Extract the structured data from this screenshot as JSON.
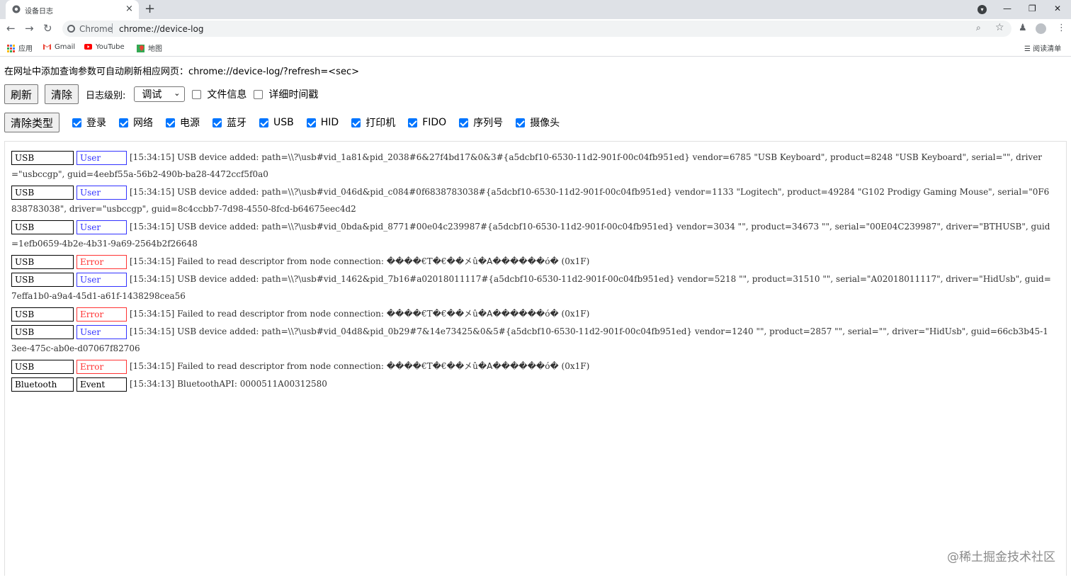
{
  "browser": {
    "tab_title": "设备日志",
    "tab_close": "×",
    "new_tab": "+",
    "omnibox_origin": "Chrome",
    "omnibox_url": "chrome://device-log",
    "window_controls": {
      "minimize": "—",
      "restore": "❐",
      "close": "✕"
    },
    "bookmarks": [
      {
        "label": "应用",
        "icon": "apps-grid-icon"
      },
      {
        "label": "Gmail",
        "icon": "gmail-icon"
      },
      {
        "label": "YouTube",
        "icon": "youtube-icon"
      },
      {
        "label": "地图",
        "icon": "maps-icon"
      }
    ],
    "reading_list": "阅读清单"
  },
  "page": {
    "hint": "在网址中添加查询参数可自动刷新相应网页：chrome://device-log/?refresh=<sec>",
    "refresh_label": "刷新",
    "clear_label": "清除",
    "log_level_label": "日志级别:",
    "log_level_value": "调试",
    "file_info_label": "文件信息",
    "detailed_timestamp_label": "详细时间戳",
    "clear_types_label": "清除类型",
    "types": [
      {
        "label": "登录",
        "checked": true
      },
      {
        "label": "网络",
        "checked": true
      },
      {
        "label": "电源",
        "checked": true
      },
      {
        "label": "蓝牙",
        "checked": true
      },
      {
        "label": "USB",
        "checked": true
      },
      {
        "label": "HID",
        "checked": true
      },
      {
        "label": "打印机",
        "checked": true
      },
      {
        "label": "FIDO",
        "checked": true
      },
      {
        "label": "序列号",
        "checked": true
      },
      {
        "label": "摄像头",
        "checked": true
      }
    ]
  },
  "log": [
    {
      "type": "USB",
      "level": "User",
      "text": "[15:34:15] USB device added: path=\\\\?\\usb#vid_1a81&pid_2038#6&27f4bd17&0&3#{a5dcbf10-6530-11d2-901f-00c04fb951ed} vendor=6785 \"USB Keyboard\", product=8248 \"USB Keyboard\", serial=\"\", driver=\"usbccgp\", guid=4eebf55a-56b2-490b-ba28-4472ccf5f0a0"
    },
    {
      "type": "USB",
      "level": "User",
      "text": "[15:34:15] USB device added: path=\\\\?\\usb#vid_046d&pid_c084#0f6838783038#{a5dcbf10-6530-11d2-901f-00c04fb951ed} vendor=1133 \"Logitech\", product=49284 \"G102 Prodigy Gaming Mouse\", serial=\"0F6838783038\", driver=\"usbccgp\", guid=8c4ccbb7-7d98-4550-8fcd-b64675eec4d2"
    },
    {
      "type": "USB",
      "level": "User",
      "text": "[15:34:15] USB device added: path=\\\\?\\usb#vid_0bda&pid_8771#00e04c239987#{a5dcbf10-6530-11d2-901f-00c04fb951ed} vendor=3034 \"\", product=34673 \"\", serial=\"00E04C239987\", driver=\"BTHUSB\", guid=1efb0659-4b2e-4b31-9a69-2564b2f26648"
    },
    {
      "type": "USB",
      "level": "Error",
      "text": "[15:34:15] Failed to read descriptor from node connection: ����€T�€��㐅û�ꓮ������ó� (0x1F)"
    },
    {
      "type": "USB",
      "level": "User",
      "text": "[15:34:15] USB device added: path=\\\\?\\usb#vid_1462&pid_7b16#a02018011117#{a5dcbf10-6530-11d2-901f-00c04fb951ed} vendor=5218 \"\", product=31510 \"\", serial=\"A02018011117\", driver=\"HidUsb\", guid=7effa1b0-a9a4-45d1-a61f-1438298cea56"
    },
    {
      "type": "USB",
      "level": "Error",
      "text": "[15:34:15] Failed to read descriptor from node connection: ����€T�€��㐅û�ꓮ������ó� (0x1F)"
    },
    {
      "type": "USB",
      "level": "User",
      "text": "[15:34:15] USB device added: path=\\\\?\\usb#vid_04d8&pid_0b29#7&14e73425&0&5#{a5dcbf10-6530-11d2-901f-00c04fb951ed} vendor=1240 \"\", product=2857 \"\", serial=\"\", driver=\"HidUsb\", guid=66cb3b45-13ee-475c-ab0e-d07067f82706"
    },
    {
      "type": "USB",
      "level": "Error",
      "text": "[15:34:15] Failed to read descriptor from node connection: ����€T�€��㐅û�ꓮ������ó� (0x1F)"
    },
    {
      "type": "Bluetooth",
      "level": "Event",
      "text": "[15:34:13] BluetoothAPI: 0000511A00312580"
    }
  ],
  "watermark": "@稀土掘金技术社区"
}
